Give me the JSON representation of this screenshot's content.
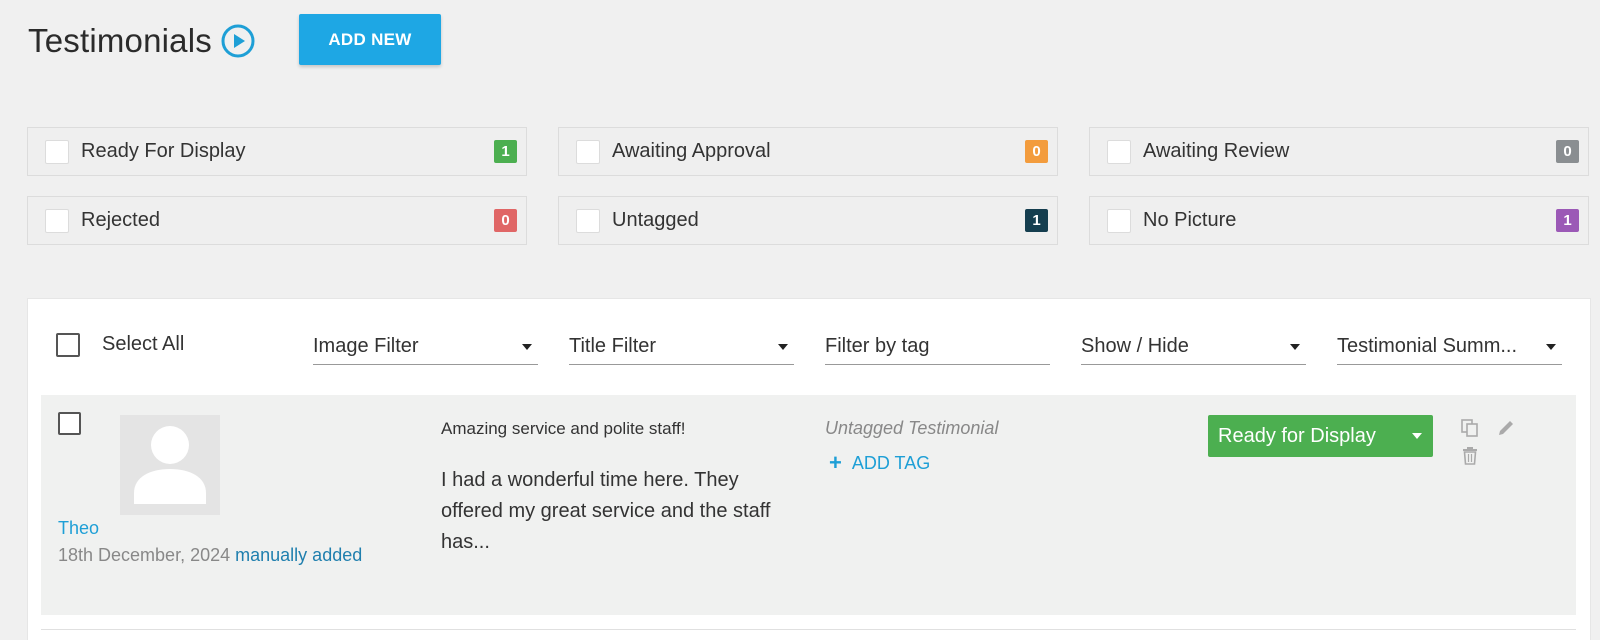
{
  "header": {
    "title": "Testimonials",
    "add_new_label": "ADD NEW"
  },
  "status_filters": [
    {
      "label": "Ready For Display",
      "count": "1",
      "color": "#4caf50"
    },
    {
      "label": "Awaiting Approval",
      "count": "0",
      "color": "#f39c3d"
    },
    {
      "label": "Awaiting Review",
      "count": "0",
      "color": "#8a8e91"
    },
    {
      "label": "Rejected",
      "count": "0",
      "color": "#e06666"
    },
    {
      "label": "Untagged",
      "count": "1",
      "color": "#153e4f"
    },
    {
      "label": "No Picture",
      "count": "1",
      "color": "#9b59b6"
    }
  ],
  "toolbar": {
    "select_all_label": "Select All",
    "image_filter": "Image Filter",
    "title_filter": "Title Filter",
    "tag_filter_placeholder": "Filter by tag",
    "show_hide": "Show / Hide",
    "summary": "Testimonial Summ..."
  },
  "testimonial": {
    "author": "Theo",
    "date": "18th December, 2024",
    "source": "manually added",
    "title": "Amazing service and polite staff!",
    "body": "I had a wonderful time here. They offered my great service and the staff has...",
    "tag_status": "Untagged Testimonial",
    "add_tag_label": "ADD TAG",
    "status": "Ready for Display"
  },
  "icons": {
    "play": "play-circle-icon",
    "copy": "copy-icon",
    "edit": "pencil-icon",
    "delete": "trash-icon",
    "avatar": "user-placeholder-icon"
  },
  "colors": {
    "accent": "#1ea7e4",
    "success": "#4caf50"
  }
}
